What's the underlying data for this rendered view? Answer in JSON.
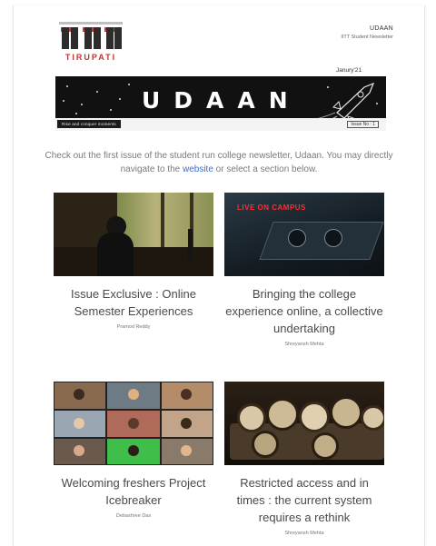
{
  "header": {
    "logo_text": "TIRUPATI",
    "brand_name": "UDAAN",
    "brand_sub": "IITT Student Newsletter"
  },
  "banner": {
    "date": "Janury'21",
    "title": "UDAAN",
    "tagline": "Rise and conquer moments",
    "issue_no": "Issue No : 1"
  },
  "intro": {
    "text_before": "Check out the first issue of the student run college newsletter, Udaan. You may directly navigate to the ",
    "link": "website",
    "text_after": " or select a section below."
  },
  "articles": [
    {
      "title": "Issue Exclusive : Online Semester Experiences",
      "author": "Pramod Reddy",
      "thumb_icon": "student-at-desk-image"
    },
    {
      "title": "Bringing the college experience online, a collective undertaking",
      "author": "Shreyansh Mehta",
      "thumb_icon": "dj-console-image",
      "thumb_caption": "LIVE ON CAMPUS"
    },
    {
      "title": "Welcoming freshers Project Icebreaker",
      "author": "Debashree Das",
      "thumb_icon": "video-call-grid-image"
    },
    {
      "title": "Restricted access and in times : the current system requires a rethink",
      "author": "Shreyansh Mehta",
      "thumb_icon": "clocks-image"
    }
  ]
}
